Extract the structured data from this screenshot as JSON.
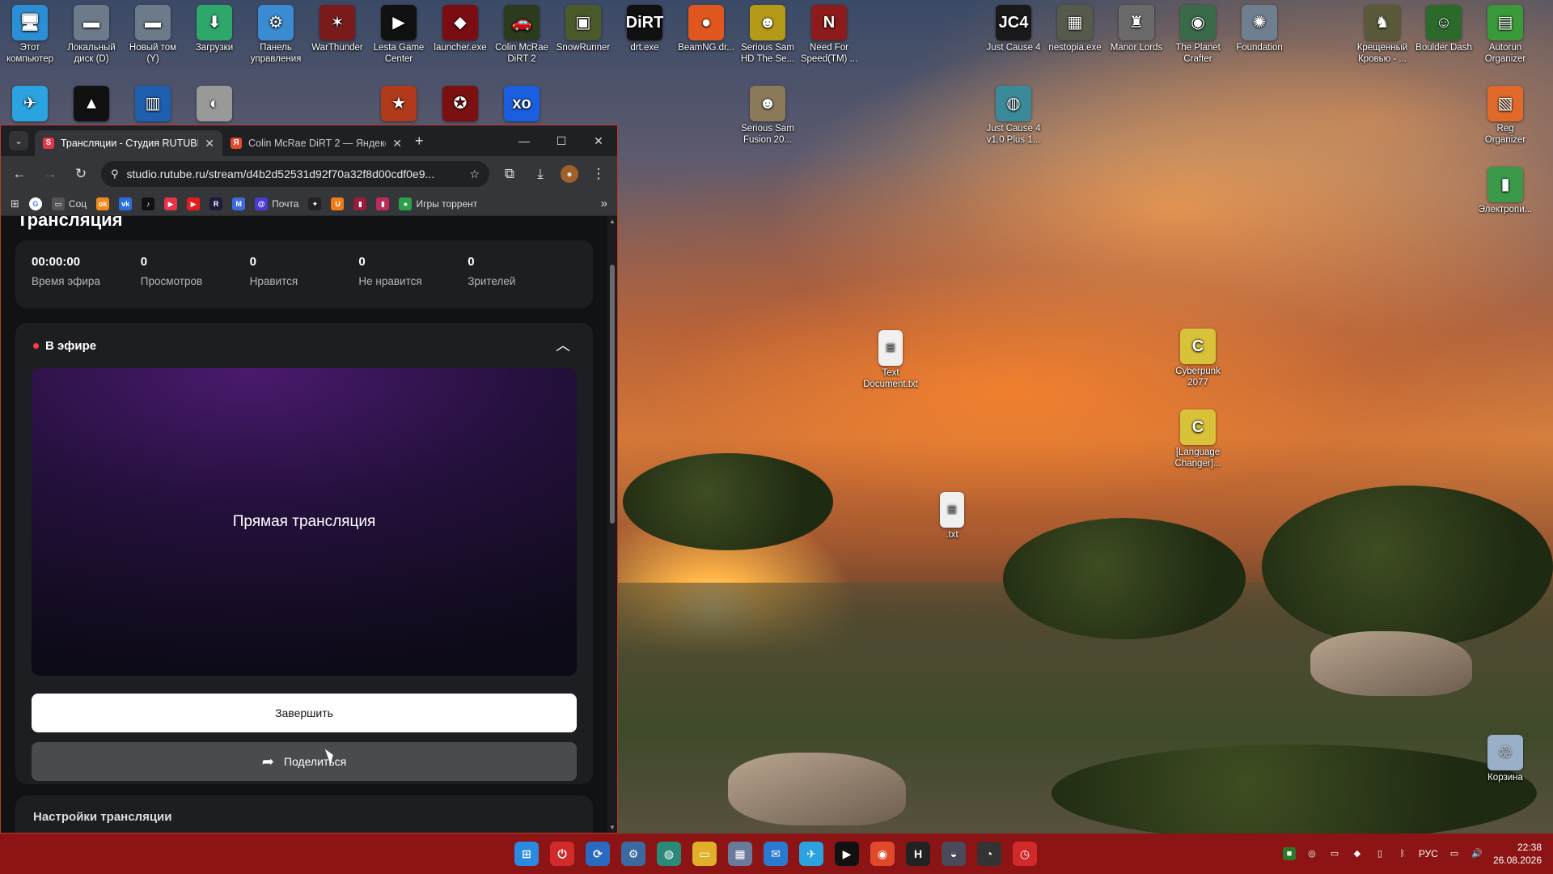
{
  "desktop": {
    "icons_top": [
      {
        "label": "Этот компьютер",
        "glyph": "🖥",
        "color": "#2b8fd6"
      },
      {
        "label": "Локальный диск (D)",
        "glyph": "▬",
        "color": "#6c7a89"
      },
      {
        "label": "Новый том (Y)",
        "glyph": "▬",
        "color": "#6c7a89"
      },
      {
        "label": "Загрузки",
        "glyph": "⬇",
        "color": "#2ea86a"
      },
      {
        "label": "Панель управления",
        "glyph": "⚙",
        "color": "#3a8bd1"
      },
      {
        "label": "WarThunder",
        "glyph": "✶",
        "color": "#7a1a1a"
      },
      {
        "label": "Lesta Game Center",
        "glyph": "▶",
        "color": "#111111"
      },
      {
        "label": "launcher.exe",
        "glyph": "◆",
        "color": "#7a0d12"
      },
      {
        "label": "Colin McRae DiRT 2",
        "glyph": "🚗",
        "color": "#2c3a1d"
      },
      {
        "label": "SnowRunner",
        "glyph": "▣",
        "color": "#4a5a2a"
      },
      {
        "label": "drt.exe",
        "glyph": "DiRT",
        "color": "#111111"
      },
      {
        "label": "BeamNG.dr...",
        "glyph": "●",
        "color": "#e0561f"
      },
      {
        "label": "Serious Sam HD The Se...",
        "glyph": "☻",
        "color": "#b59a1a"
      },
      {
        "label": "Need For Speed(TM) ...",
        "glyph": "N",
        "color": "#8d1b1b"
      },
      {
        "label": "Just Cause 4",
        "glyph": "JC4",
        "color": "#1a1a1a"
      },
      {
        "label": "nestopia.exe",
        "glyph": "▦",
        "color": "#555a4a"
      },
      {
        "label": "Manor Lords",
        "glyph": "♜",
        "color": "#6a6a6a"
      },
      {
        "label": "The Planet Crafter",
        "glyph": "◉",
        "color": "#3a6a4a"
      },
      {
        "label": "Foundation",
        "glyph": "✺",
        "color": "#6f7f8f"
      },
      {
        "label": "Крещенный Кровью - ...",
        "glyph": "♞",
        "color": "#5a5a3a"
      },
      {
        "label": "Boulder Dash",
        "glyph": "☺",
        "color": "#2c6a2c"
      },
      {
        "label": "Autorun Organizer",
        "glyph": "▤",
        "color": "#3a9a3a"
      }
    ],
    "icons_row2": [
      {
        "label": "",
        "glyph": "✈",
        "color": "#2aa3e0"
      },
      {
        "label": "",
        "glyph": "▲",
        "color": "#111111"
      },
      {
        "label": "",
        "glyph": "▥",
        "color": "#1f5fb0"
      },
      {
        "label": "",
        "glyph": "◐",
        "color": "#999999"
      },
      {
        "label": "",
        "glyph": "★",
        "color": "#b03a1a"
      },
      {
        "label": "",
        "glyph": "✪",
        "color": "#7a1010"
      },
      {
        "label": "",
        "glyph": "xo",
        "color": "#1b5fe0"
      },
      {
        "label": "Serious Sam Fusion 20...",
        "glyph": "☻",
        "color": "#8a7a5a"
      },
      {
        "label": "Just Cause 4 v1.0 Plus 1...",
        "glyph": "◍",
        "color": "#3a8a9a"
      },
      {
        "label": "Reg Organizer",
        "glyph": "▧",
        "color": "#e06a2a"
      },
      {
        "label": "Электропи...",
        "glyph": "▮",
        "color": "#3a9a4a"
      }
    ],
    "icons_files": [
      {
        "label": "Text Document.txt",
        "glyph": "≡",
        "color": "#f0f0f0"
      },
      {
        "label": "Cyberpunk 2077",
        "glyph": "C",
        "color": "#d8c23a"
      },
      {
        "label": "[Language Changer]...",
        "glyph": "C",
        "color": "#d8c23a"
      },
      {
        "label": ".txt",
        "glyph": "≡",
        "color": "#f0f0f0"
      },
      {
        "label": "Корзина",
        "glyph": "♲",
        "color": "#9ab0c8"
      }
    ]
  },
  "browser": {
    "tabs": [
      {
        "title": "Трансляции - Студия RUTUBE",
        "favicon": "S",
        "favicon_color": "#e8344a"
      },
      {
        "title": "Colin McRae DiRT 2 — Яндекс",
        "favicon": "Я",
        "favicon_color": "#e64a2e"
      }
    ],
    "new_tab": "+",
    "window_controls": {
      "minimize": "—",
      "maximize": "☐",
      "close": "✕"
    },
    "url": "studio.rutube.ru/stream/d4b2d52531d92f70a32f8d00cdf0e9...",
    "bookmarks": [
      {
        "label": "Соц",
        "glyph": "▭",
        "color": "#555"
      },
      {
        "label": "",
        "glyph": "ok",
        "color": "#f28a1a"
      },
      {
        "label": "",
        "glyph": "vk",
        "color": "#2a6fe0"
      },
      {
        "label": "",
        "glyph": "♪",
        "color": "#111"
      },
      {
        "label": "",
        "glyph": "▶",
        "color": "#e8344a"
      },
      {
        "label": "",
        "glyph": "▶",
        "color": "#e61c1c"
      },
      {
        "label": "",
        "glyph": "R",
        "color": "#1c1c3a"
      },
      {
        "label": "",
        "glyph": "M",
        "color": "#3a6ae0"
      },
      {
        "label": "Почта",
        "glyph": "@",
        "color": "#4a3ad0"
      },
      {
        "label": "",
        "glyph": "✦",
        "color": "#222"
      },
      {
        "label": "",
        "glyph": "U",
        "color": "#f07a1a"
      },
      {
        "label": "",
        "glyph": "▮",
        "color": "#9a1a3a"
      },
      {
        "label": "",
        "glyph": "▮",
        "color": "#c02a5a"
      },
      {
        "label": "Игры торрент",
        "glyph": "●",
        "color": "#2aa04a"
      }
    ],
    "more_bookmarks": "»"
  },
  "page": {
    "title": "Трансляция",
    "stats": [
      {
        "value": "00:00:00",
        "label": "Время эфира"
      },
      {
        "value": "0",
        "label": "Просмотров"
      },
      {
        "value": "0",
        "label": "Нравится"
      },
      {
        "value": "0",
        "label": "Не нравится"
      },
      {
        "value": "0",
        "label": "Зрителей"
      }
    ],
    "live_section": {
      "heading": "В эфире",
      "player_text": "Прямая трансляция",
      "end_button": "Завершить",
      "share_button": "Поделиться"
    },
    "settings_heading": "Настройки трансляции"
  },
  "taskbar": {
    "apps": [
      {
        "name": "start",
        "glyph": "⊞",
        "color": "#2a8ae0"
      },
      {
        "name": "app-1",
        "glyph": "⏻",
        "color": "#d02a2a"
      },
      {
        "name": "app-2",
        "glyph": "⟳",
        "color": "#2a6ac0"
      },
      {
        "name": "app-3",
        "glyph": "⚙",
        "color": "#3a6aa0"
      },
      {
        "name": "app-4",
        "glyph": "◍",
        "color": "#2a8a7a"
      },
      {
        "name": "app-5",
        "glyph": "▭",
        "color": "#e0b02a"
      },
      {
        "name": "app-6",
        "glyph": "▦",
        "color": "#6a7a9a"
      },
      {
        "name": "app-7",
        "glyph": "✉",
        "color": "#2a7ad0"
      },
      {
        "name": "app-8",
        "glyph": "✈",
        "color": "#2aa3e0"
      },
      {
        "name": "app-9",
        "glyph": "▶",
        "color": "#111111"
      },
      {
        "name": "app-10",
        "glyph": "◉",
        "color": "#e04a2a"
      },
      {
        "name": "app-11",
        "glyph": "H",
        "color": "#222222"
      },
      {
        "name": "app-12",
        "glyph": "◒",
        "color": "#4a4a5a"
      },
      {
        "name": "app-13",
        "glyph": "◔",
        "color": "#333333"
      },
      {
        "name": "app-14",
        "glyph": "◷",
        "color": "#d02a2a"
      }
    ],
    "tray": {
      "language": "РУС",
      "time": "22:38",
      "date": "26.08.2026"
    }
  }
}
